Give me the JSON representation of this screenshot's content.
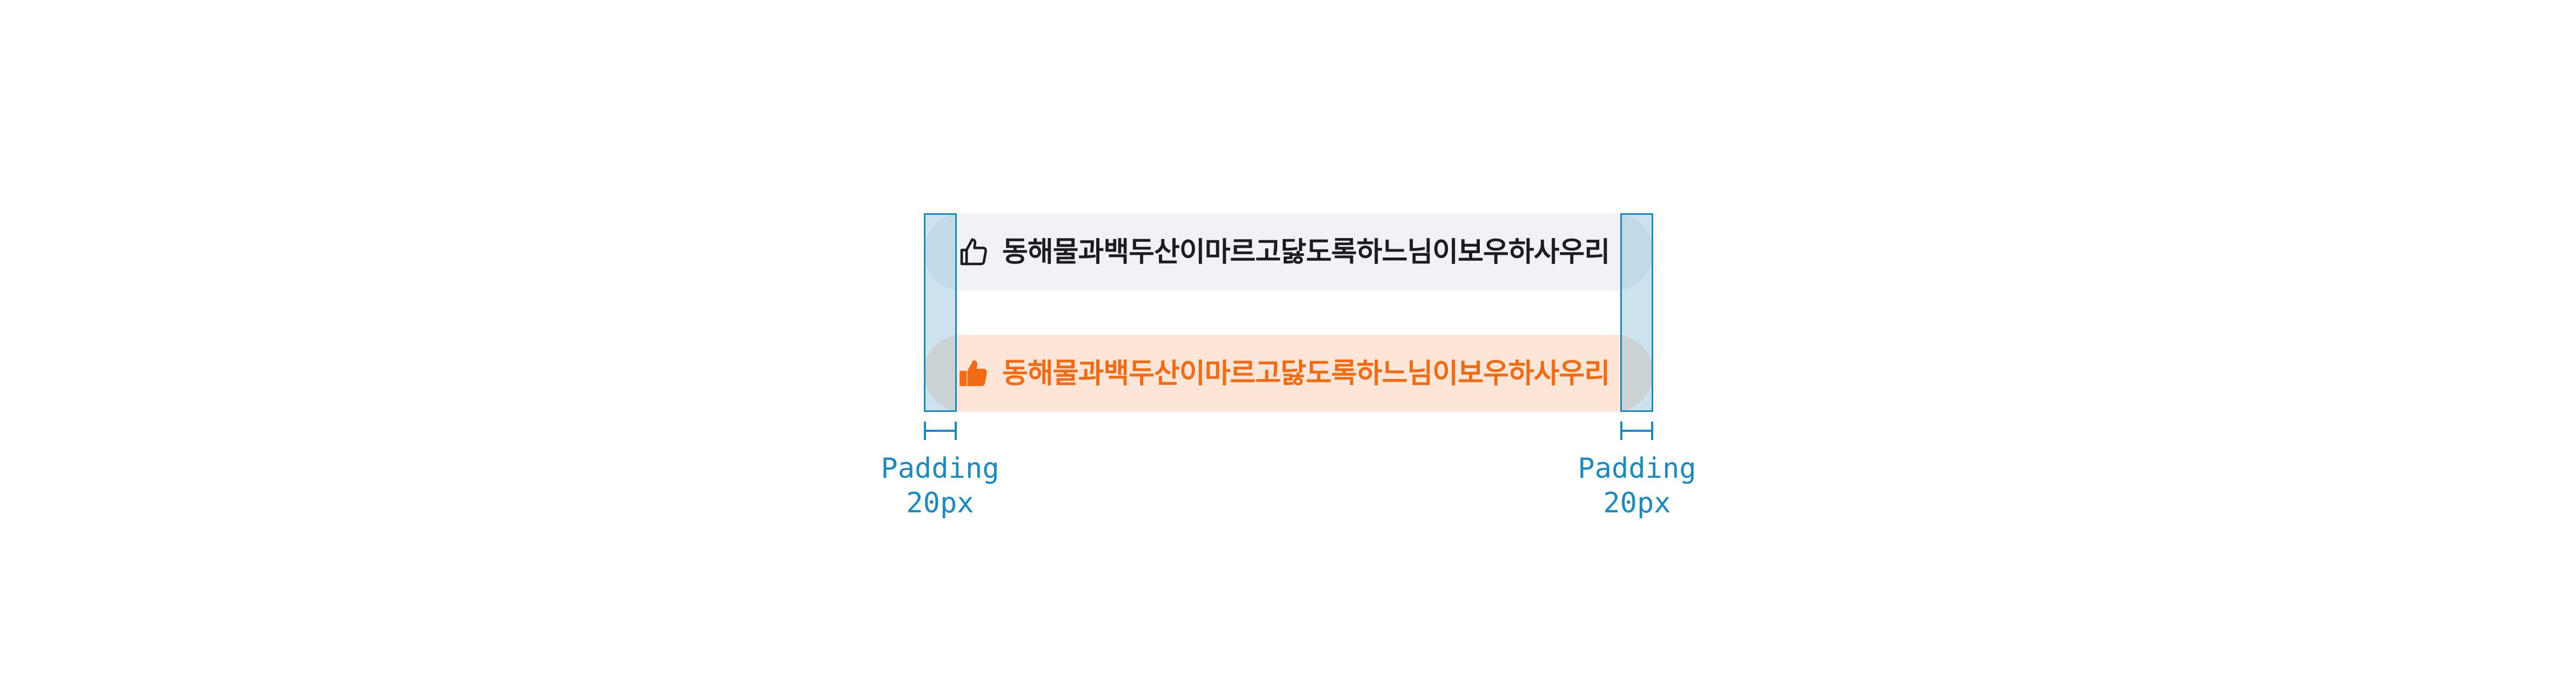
{
  "chips": {
    "default": {
      "icon": "thumbs-up-outline-icon",
      "label": "동해물과백두산이마르고닳도록하느님이보우하사우리",
      "text_color": "#1b1d22",
      "background": "#f0f2f5"
    },
    "active": {
      "icon": "thumbs-up-filled-icon",
      "label": "동해물과백두산이마르고닳도록하느님이보우하사우리",
      "text_color": "#f26b13",
      "background": "#fde6d8"
    }
  },
  "annotations": {
    "left": {
      "line1": "Padding",
      "line2": "20px"
    },
    "right": {
      "line1": "Padding",
      "line2": "20px"
    },
    "color": "#1a8ac2"
  }
}
